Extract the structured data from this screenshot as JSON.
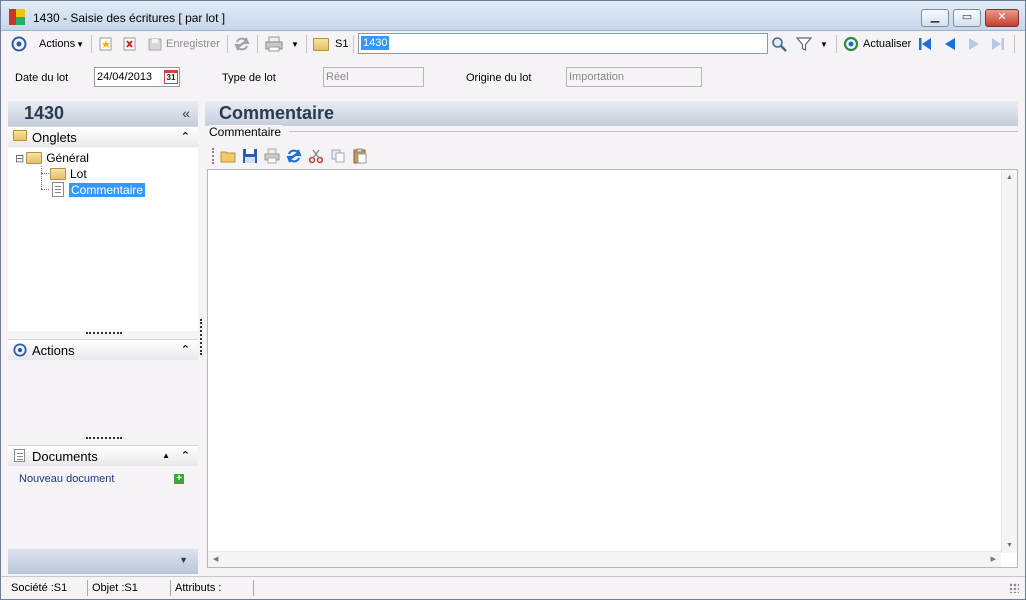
{
  "window": {
    "title": "1430 -  Saisie des écritures [ par lot ]",
    "buttons": {
      "minimize": "▁",
      "maximize": "▭",
      "close": "✕"
    }
  },
  "toolbar": {
    "actions_label": "Actions",
    "save_label": "Enregistrer",
    "company_label": "S1",
    "search_value": "1430",
    "refresh_label": "Actualiser"
  },
  "header": {
    "date_label": "Date du lot",
    "date_value": "24/04/2013",
    "calendar_icon_text": "31",
    "type_label": "Type de lot",
    "type_value": "Réel",
    "origin_label": "Origine du lot",
    "origin_value": "Importation"
  },
  "left_panel": {
    "title": "1430",
    "collapse_glyph": "«",
    "tabs_section": {
      "title": "Onglets",
      "chevron": "⌃",
      "tree": [
        {
          "label": "Général",
          "expander": "⊟"
        },
        {
          "label": "Lot"
        },
        {
          "label": "Commentaire",
          "selected": true
        }
      ]
    },
    "actions_section": {
      "title": "Actions",
      "chevron": "⌃"
    },
    "documents_section": {
      "title": "Documents",
      "up": "▲",
      "chevron": "⌃",
      "new_document_label": "Nouveau document",
      "add_glyph": "+"
    },
    "footer_arrow": "▼"
  },
  "main": {
    "title": "Commentaire",
    "group_label": "Commentaire",
    "editor_content": ""
  },
  "statusbar": {
    "company": "Société :S1",
    "object": "Objet :S1",
    "attributes": "Attributs :"
  },
  "colors": {
    "accent_blue": "#3399ff",
    "header_gradient_top": "#e9edf3",
    "header_gradient_bottom": "#c3cedb",
    "close_red": "#c2402c",
    "nav_blue": "#1c6fd1"
  }
}
